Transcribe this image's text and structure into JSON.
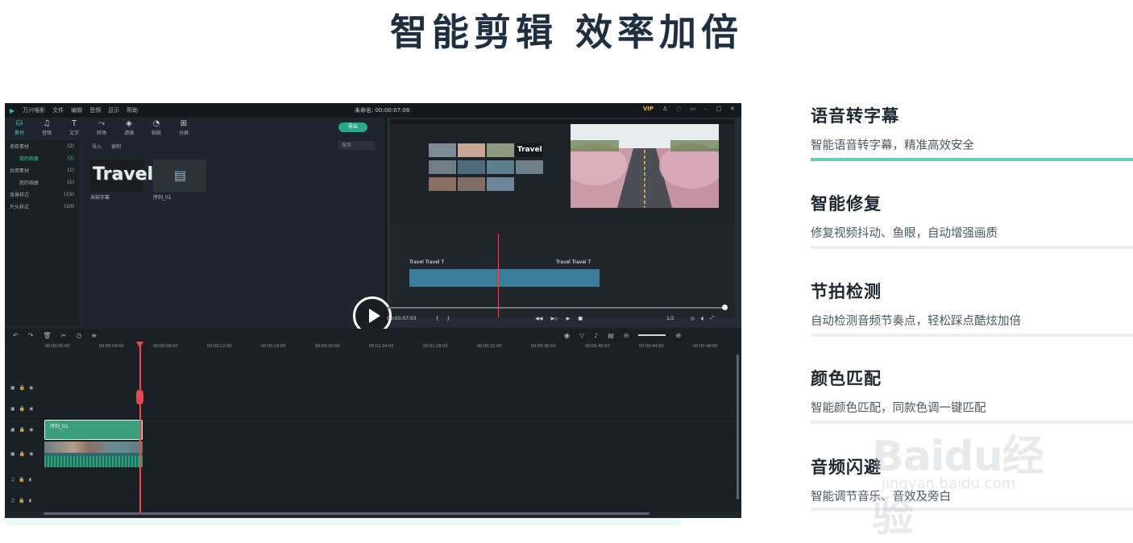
{
  "heading": "智能剪辑 效率加倍",
  "app": {
    "title_menus": [
      "万兴喵影",
      "文件",
      "编辑",
      "音频",
      "显示",
      "帮助"
    ],
    "project_title": "未命名: 00:00:07:08",
    "vip_label": "VIP",
    "media_tabs": [
      {
        "label": "素材",
        "icon": "folder-icon"
      },
      {
        "label": "音频",
        "icon": "music-note-icon"
      },
      {
        "label": "文字",
        "icon": "text-icon"
      },
      {
        "label": "转场",
        "icon": "transition-icon"
      },
      {
        "label": "滤镜",
        "icon": "filter-icon"
      },
      {
        "label": "贴纸",
        "icon": "sticker-icon"
      },
      {
        "label": "分屏",
        "icon": "split-screen-icon"
      }
    ],
    "export_label": "导出",
    "sidebar": [
      {
        "label": "项目素材",
        "count": "(2)"
      },
      {
        "label": "我的相册",
        "count": "(2)"
      },
      {
        "label": "共用素材",
        "count": "(1)"
      },
      {
        "label": "我的相册",
        "count": "(1)"
      },
      {
        "label": "背景样式",
        "count": "(15)"
      },
      {
        "label": "片头样式",
        "count": "(20)"
      }
    ],
    "media_bar": {
      "import_label": "导入",
      "record_label": "录制",
      "search_placeholder": "搜索"
    },
    "media_items": [
      {
        "title": "未知字幕",
        "preview_text": "Travel"
      },
      {
        "title": "序列_01"
      }
    ],
    "playback": {
      "timecode": "00:00:07:03",
      "ratio": "1/2"
    },
    "ruler_labels": [
      "00:00:00:00",
      "00:00:04:00",
      "00:00:08:00",
      "00:00:12:00",
      "00:00:16:00",
      "00:00:20:00",
      "00:01:24:00",
      "00:01:28:00",
      "00:00:32:00",
      "00:00:36:00",
      "00:00:40:00",
      "00:00:44:00",
      "00:00:48:00"
    ],
    "clip_label": "序列_01",
    "inner_travel_label": "Travel"
  },
  "features": [
    {
      "title": "语音转字幕",
      "desc": "智能语音转字幕，精准高效安全",
      "active": true
    },
    {
      "title": "智能修复",
      "desc": "修复视频抖动、鱼眼，自动增强画质",
      "active": false
    },
    {
      "title": "节拍检测",
      "desc": "自动检测音频节奏点，轻松踩点酷炫加倍",
      "active": false
    },
    {
      "title": "颜色匹配",
      "desc": "智能颜色匹配，同款色调一键匹配",
      "active": false
    },
    {
      "title": "音频闪避",
      "desc": "智能调节音乐、音效及旁白",
      "active": false
    }
  ],
  "watermark": {
    "main": "Baidu经验",
    "sub": "jingyan.baidu.com"
  },
  "colors": {
    "accent": "#5bd3b6",
    "app_bg": "#1f252c",
    "clip_green": "#3b9e7c",
    "playhead": "#e8484f"
  }
}
